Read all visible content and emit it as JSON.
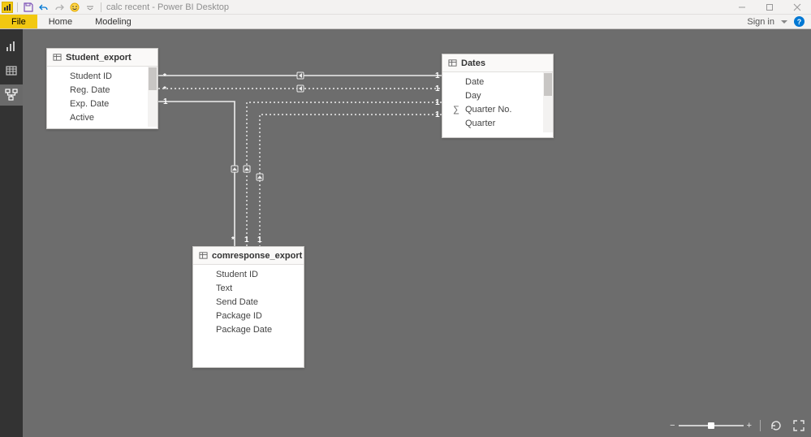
{
  "title": "calc recent - Power BI Desktop",
  "ribbon": {
    "file": "File",
    "tabs": [
      "Home",
      "Modeling"
    ],
    "signin": "Sign in"
  },
  "tables": {
    "student": {
      "name": "Student_export",
      "fields": [
        "Student ID",
        "Reg. Date",
        "Exp. Date",
        "Active"
      ]
    },
    "dates": {
      "name": "Dates",
      "fields": [
        "Date",
        "Day",
        "Quarter No.",
        "Quarter"
      ],
      "sigma_index": 2
    },
    "comresponse": {
      "name": "comresponse_export",
      "fields": [
        "Student ID",
        "Text",
        "Send Date",
        "Package ID",
        "Package Date"
      ]
    }
  },
  "cardinality": {
    "many": "*",
    "one": "1"
  }
}
